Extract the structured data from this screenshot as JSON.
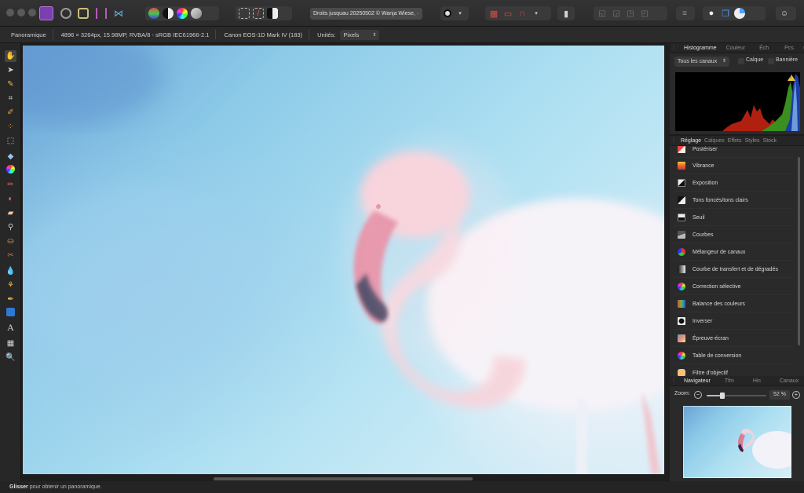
{
  "titlebar": {
    "document_title": "Droits jusquau 20250502 © Wanja Wiese, ·"
  },
  "context": {
    "tool": "Panoramique",
    "dimensions": "4896 × 3264px, 15.98MP, RVBA/8 - sRGB IEC61966-2.1",
    "camera": "Canon EOS-1D Mark IV (183)",
    "units_label": "Unités:",
    "units_value": "Pixels"
  },
  "histogram_panel": {
    "tabs": [
      "Histogramme",
      "Couleur",
      "Éch",
      "Pcs"
    ],
    "channel": "Tous les canaux",
    "option_layer": "Calque",
    "option_banner": "Bannière",
    "warning": "!"
  },
  "adjust_panel": {
    "tabs": [
      "Réglage",
      "Calques",
      "Effets",
      "Styles",
      "Stock"
    ],
    "items": [
      "Postériser",
      "Vibrance",
      "Exposition",
      "Tons foncés/tons clairs",
      "Seuil",
      "Courbes",
      "Mélangeur de canaux",
      "Courbe de transfert et de dégradés",
      "Correction sélective",
      "Balance des couleurs",
      "Inverser",
      "Épreuve-écran",
      "Table de conversion",
      "Filtre d'objectif"
    ]
  },
  "navigator_panel": {
    "tabs": [
      "Navigateur",
      "Tfm",
      "His",
      "Canaux"
    ],
    "zoom_label": "Zoom:",
    "zoom_value": "52 %",
    "zoom_level": 0.52
  },
  "status": {
    "bold": "Glisser",
    "text": " pour obtenir un panoramique."
  }
}
